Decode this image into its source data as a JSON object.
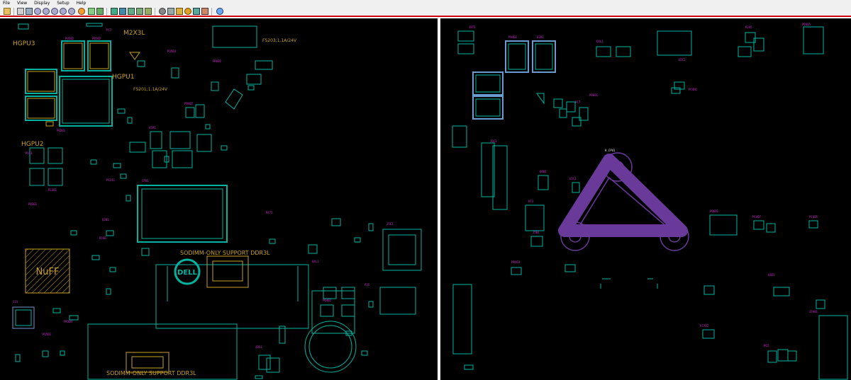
{
  "menu": [
    {
      "label": "File"
    },
    {
      "label": "View"
    },
    {
      "label": "Display"
    },
    {
      "label": "Setup"
    },
    {
      "label": "Help"
    }
  ],
  "toolbar_icons": [
    "open-icon",
    "print-icon",
    "fit-icon",
    "zoom-in-icon",
    "zoom-out-icon",
    "zoom-area-icon",
    "zoom-prev-icon",
    "zoom-fit-icon",
    "pan-icon",
    "highlight-icon",
    "layer-icon",
    "top-side-icon",
    "bottom-side-icon",
    "flip-icon",
    "mirror-icon",
    "net-icon",
    "find-icon",
    "part-icon",
    "settings-icon",
    "tools-icon",
    "info-icon"
  ],
  "colors": {
    "outline": "#00b4a0",
    "label": "#d22ad2",
    "silk": "#c8a020",
    "board_detail": "#6a3a9a",
    "white_text": "#e0e0e0"
  },
  "left_view": {
    "labels": {
      "hgpu3": "HGPU3",
      "hgpu1": "HGPU1",
      "hgpu2": "HGPU2",
      "m2x3l": "M2X3L",
      "fuse1": "F5203;1.1A/24V",
      "fuse2": "F5201;1.1A/24V",
      "sodimm_top": "SODIMM-ONLY SUPPORT DDR3L",
      "sodimm_bottom": "SODIMM-ONLY SUPPORT DDR3L",
      "nuff": "NuFF",
      "dell": "DELL"
    },
    "part_labels": [
      "PU502",
      "PQ502",
      "CPU1",
      "PQ503",
      "U5R1",
      "PQ407",
      "PR602",
      "PC7",
      "J5C1",
      "PU11",
      "Q7B1",
      "PQ201",
      "JB51",
      "PJ5",
      "J31",
      "PU501",
      "R5S6",
      "PC211",
      "PQ301",
      "PL301",
      "PR304",
      "U4L1",
      "PQ402",
      "R471"
    ]
  },
  "right_view": {
    "part_labels": [
      "JBT1",
      "Q4L1",
      "PU402",
      "PC7",
      "U2D1",
      "U5C1",
      "PQ405",
      "RJ45",
      "J6C3",
      "PJ702",
      "UC1",
      "PQ601",
      "Q4E1",
      "J501",
      "U3C1",
      "PC407",
      "PC405",
      "PR503",
      "JFAN1",
      "Q6B1",
      "PU601",
      "PC4N1",
      "PQ2"
    ],
    "ref": "H_CPU1"
  }
}
